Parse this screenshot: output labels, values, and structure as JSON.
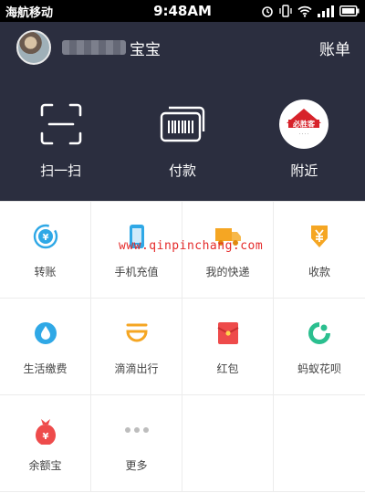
{
  "status_bar": {
    "carrier": "海航移动",
    "time": "9:48AM",
    "icons": [
      "alarm-icon",
      "vibrate-icon",
      "wifi-icon",
      "signal-icon",
      "battery-icon"
    ]
  },
  "header": {
    "user_name": "宝宝",
    "bill_label": "账单",
    "quick_actions": [
      {
        "label": "扫一扫",
        "icon": "scan-icon"
      },
      {
        "label": "付款",
        "icon": "barcode-pay-icon"
      },
      {
        "label": "附近",
        "icon": "pizza-hut-logo"
      }
    ]
  },
  "grid": {
    "items": [
      {
        "label": "转账",
        "icon": "transfer-icon",
        "color": "#2fa8e6"
      },
      {
        "label": "手机充值",
        "icon": "phone-recharge-icon",
        "color": "#2fa8e6"
      },
      {
        "label": "我的快递",
        "icon": "delivery-truck-icon",
        "color": "#f5a623"
      },
      {
        "label": "收款",
        "icon": "receive-money-icon",
        "color": "#f5a623"
      },
      {
        "label": "生活缴费",
        "icon": "water-drop-icon",
        "color": "#2fa8e6"
      },
      {
        "label": "滴滴出行",
        "icon": "didi-icon",
        "color": "#f5a623"
      },
      {
        "label": "红包",
        "icon": "red-envelope-icon",
        "color": "#ee4b4b"
      },
      {
        "label": "蚂蚁花呗",
        "icon": "huabei-icon",
        "color": "#2bbf8f"
      },
      {
        "label": "余额宝",
        "icon": "money-bag-icon",
        "color": "#ee4b4b"
      },
      {
        "label": "更多",
        "icon": "more-dots-icon",
        "color": "#bdbdbd"
      }
    ]
  },
  "watermark": "www.qinpinchang.com",
  "logo_text": "必胜客"
}
